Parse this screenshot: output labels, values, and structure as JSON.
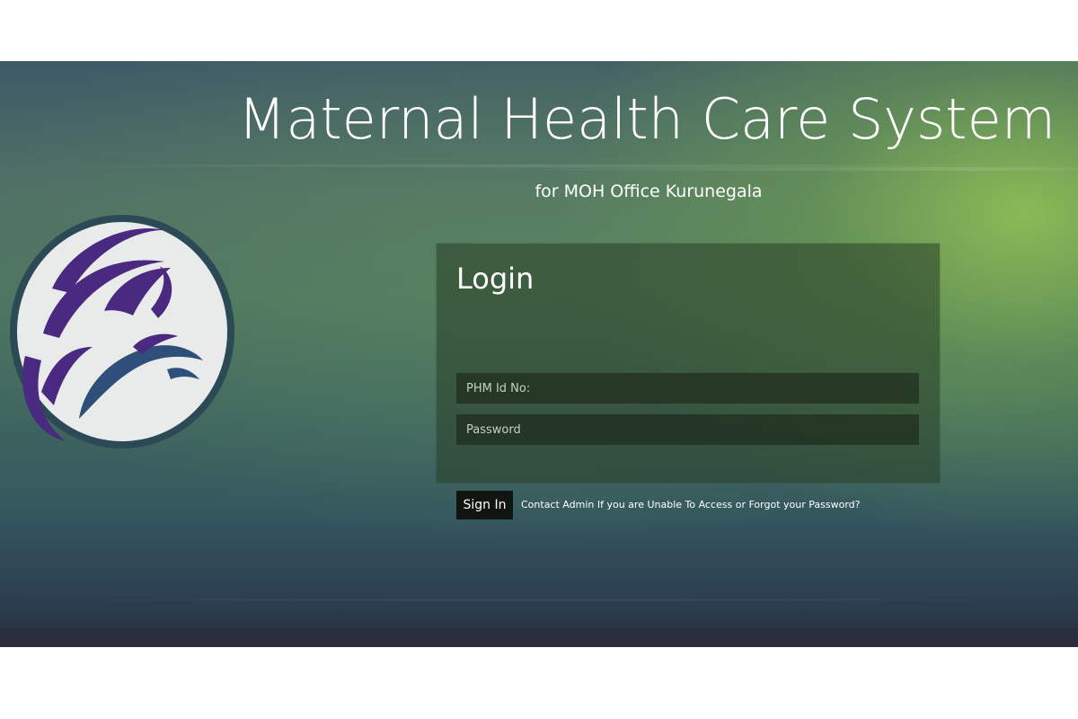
{
  "header": {
    "title": "Maternal Health Care System",
    "subtitle": "for MOH Office Kurunegala"
  },
  "logo": {
    "icon": "mother-and-child-logo-icon",
    "colors": {
      "ring": "#2c4a55",
      "disc": "#e9ebea",
      "mother": "#4a2a80",
      "child": "#2d4f7a"
    }
  },
  "login": {
    "title": "Login",
    "phm_field": {
      "placeholder": "PHM Id No:",
      "value": ""
    },
    "password_field": {
      "placeholder": "Password",
      "value": ""
    },
    "signin_label": "Sign In",
    "help_text": "Contact Admin If you are Unable To Access or Forgot your Password?"
  },
  "colors": {
    "background_top": "#3f5a66",
    "background_glow": "#8dbe54",
    "background_bottom": "#29303f",
    "panel": "#283e26",
    "button": "#111511"
  }
}
